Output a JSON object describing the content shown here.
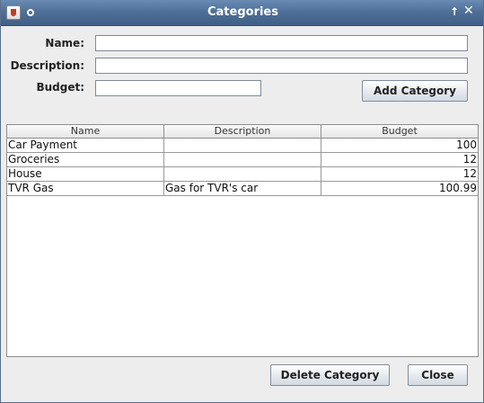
{
  "window": {
    "title": "Categories"
  },
  "form": {
    "name_label": "Name:",
    "name_value": "",
    "description_label": "Description:",
    "description_value": "",
    "budget_label": "Budget:",
    "budget_value": "",
    "add_button_label": "Add Category"
  },
  "table": {
    "columns": [
      "Name",
      "Description",
      "Budget"
    ],
    "rows": [
      {
        "name": "Car Payment",
        "description": "",
        "budget": "100"
      },
      {
        "name": "Groceries",
        "description": "",
        "budget": "12"
      },
      {
        "name": "House",
        "description": "",
        "budget": "12"
      },
      {
        "name": "TVR Gas",
        "description": "Gas for TVR's car",
        "budget": "100.99"
      }
    ]
  },
  "footer": {
    "delete_button_label": "Delete Category",
    "close_button_label": "Close"
  },
  "icons": {
    "title_bar": [
      "java-app-icon",
      "window-menu-icon",
      "maximize-icon",
      "close-icon"
    ]
  }
}
